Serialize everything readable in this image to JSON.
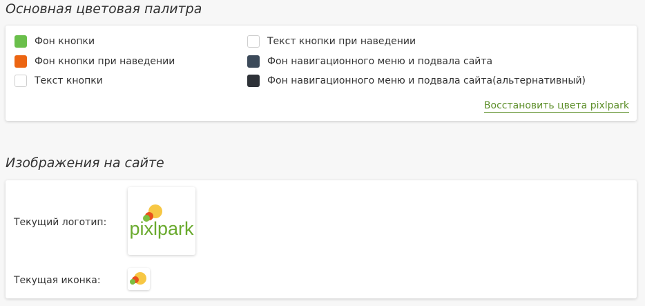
{
  "palette": {
    "title": "Основная цветовая палитра",
    "left_items": [
      {
        "label": "Фон кнопки",
        "color": "#6abf4b"
      },
      {
        "label": "Фон кнопки при наведении",
        "color": "#ec6512"
      },
      {
        "label": "Текст кнопки",
        "color": "#ffffff"
      }
    ],
    "right_items": [
      {
        "label": "Текст кнопки при наведении",
        "color": "#ffffff"
      },
      {
        "label": "Фон навигационного меню и подвала сайта",
        "color": "#3c4a5a"
      },
      {
        "label": "Фон навигационного меню и подвала сайта(альтернативный)",
        "color": "#2e3238"
      }
    ],
    "restore_label": "Восстановить цвета pixlpark",
    "link_color": "#5d8f2a"
  },
  "images": {
    "title": "Изображения на сайте",
    "logo_label": "Текущий логотип:",
    "icon_label": "Текущая иконка:",
    "logo": {
      "name": "pixlpark-logo",
      "text": "pixlpark",
      "text_color": "#6aaa2e",
      "sun_color": "#f7c744",
      "dot_colors": [
        "#e8501c",
        "#7cbf3f"
      ]
    }
  }
}
